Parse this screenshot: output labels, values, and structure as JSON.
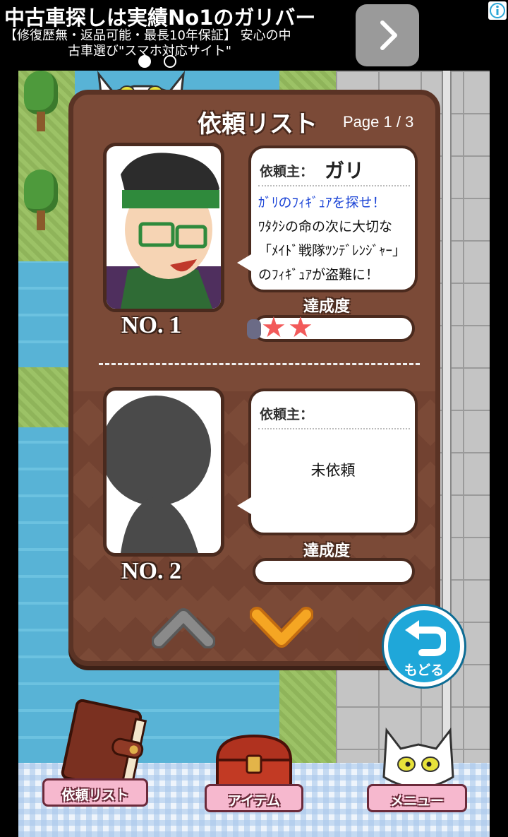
{
  "ad": {
    "title": "中古車探しは実績No1のガリバー",
    "line1": "【修復歴無・返品可能・最長10年保証】 安心の中",
    "line2": "古車選び\"スマホ対応サイト\"",
    "next_icon": "chevron-right-icon",
    "info_icon": "info-icon"
  },
  "panel": {
    "title": "依頼リスト",
    "page": "Page 1 / 3",
    "cards": [
      {
        "number": "NO. 1",
        "client_label": "依頼主：",
        "client_name": "ガリ",
        "lines": [
          "ｶﾞﾘのﾌｨｷﾞｭｱを探せ！",
          "ﾜﾀｸｼの命の次に大切な",
          "「ﾒｲﾄﾞ戦隊ﾂﾝﾃﾞﾚﾝｼﾞｬｰ」",
          "のﾌｨｷﾞｭｱが盗難に！"
        ],
        "achievement_label": "達成度",
        "stars": 2
      },
      {
        "number": "NO. 2",
        "client_label": "依頼主：",
        "status": "未依頼",
        "achievement_label": "達成度",
        "stars": 0
      }
    ]
  },
  "nav": {
    "up_icon": "chevron-up-icon",
    "down_icon": "chevron-down-icon"
  },
  "back": {
    "label": "もどる",
    "icon": "return-arrow-icon"
  },
  "menu": {
    "items": [
      {
        "label": "依頼リスト",
        "icon": "book-icon"
      },
      {
        "label": "アイテム",
        "icon": "treasure-chest-icon"
      },
      {
        "label": "メニュー",
        "icon": "white-cat-icon"
      }
    ]
  },
  "colors": {
    "panel": "#7b4a37",
    "panel_border": "#5a3325",
    "star": "#f25a5a",
    "down_arrow": "#f5a623",
    "up_arrow": "#8a8a8a",
    "back_button": "#1fa7d9",
    "ribbon": "#f6b8ce"
  }
}
